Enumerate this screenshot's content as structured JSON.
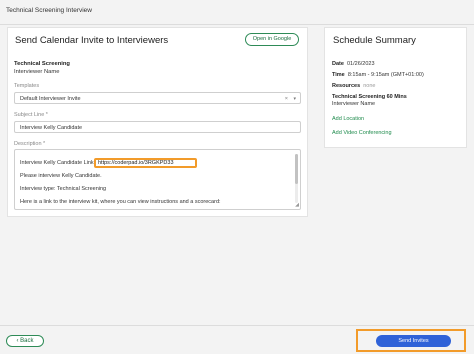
{
  "window": {
    "title": "Technical Screening Interview"
  },
  "invite": {
    "heading": "Send Calendar Invite to Interviewers",
    "open_google_label": "Open in Google",
    "interview_name": "Technical Screening",
    "interview_sub": "Interviewer Name",
    "templates_label": "Templates",
    "template_value": "Default Interviewer Invite",
    "template_clear": "×",
    "template_chevron": "▾",
    "subject_label": "Subject Line *",
    "subject_value": "Interview Kelly Candidate",
    "description_label": "Description *",
    "description_prefix": "Interview Kelly Candidate Link:",
    "description_link": "https://coderpad.io/3RGKPD33",
    "description_lines": [
      "Please interview Kelly Candidate.",
      "Interview type: Technical Screening",
      "Here is a link to the interview kit, where you can view instructions and a scorecard:"
    ]
  },
  "summary": {
    "heading": "Schedule Summary",
    "date_label": "Date",
    "date_value": "01/26/2023",
    "time_label": "Time",
    "time_value": "8:15am - 9:15am (GMT+01:00)",
    "resources_label": "Resources",
    "resources_value": "none",
    "event_title": "Technical Screening 60 Mins",
    "event_sub": "Interviewer Name",
    "add_location": "Add Location",
    "add_video": "Add Video Conferencing"
  },
  "footer": {
    "back_label": "Back",
    "back_icon": "chevron-left-icon",
    "send_label": "Send Invites"
  },
  "colors": {
    "accent_green": "#1d8a4b",
    "primary_blue": "#2f62d8",
    "highlight_orange": "#f29b2a"
  }
}
